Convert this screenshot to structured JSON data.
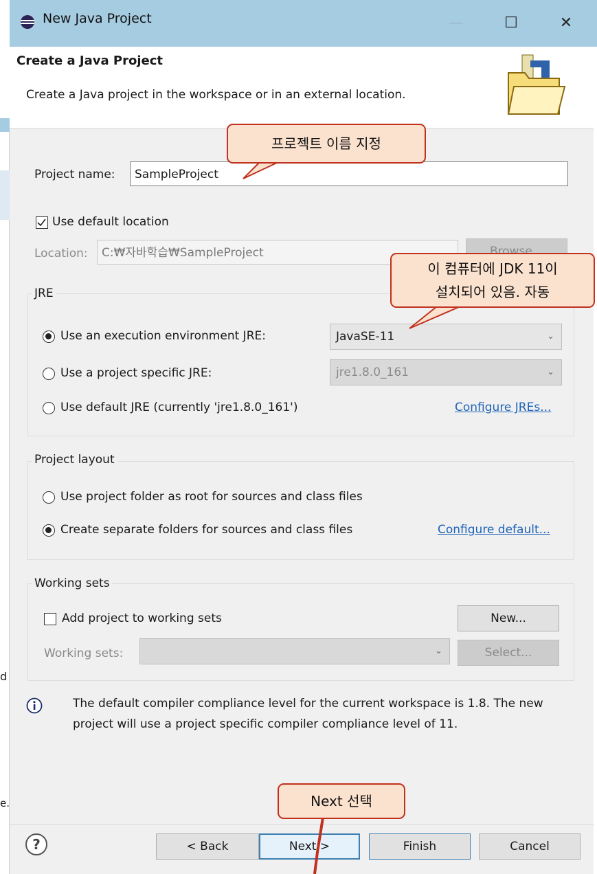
{
  "window": {
    "title": "New Java Project",
    "minimize": "—",
    "maximize": "☐",
    "close": "✕"
  },
  "header": {
    "title": "Create a Java Project",
    "description": "Create a Java project in the workspace or in an external location."
  },
  "project_name": {
    "label": "Project name:",
    "value": "SampleProject"
  },
  "location": {
    "use_default_label": "Use default location",
    "use_default_checked": true,
    "label": "Location:",
    "value": "C:₩자바학습₩SampleProject",
    "browse": "Browse..."
  },
  "jre": {
    "group": "JRE",
    "opt_env": "Use an execution environment JRE:",
    "opt_env_value": "JavaSE-11",
    "opt_project": "Use a project specific JRE:",
    "opt_project_value": "jre1.8.0_161",
    "opt_default": "Use default JRE (currently 'jre1.8.0_161')",
    "configure": "Configure JREs..."
  },
  "layout": {
    "group": "Project layout",
    "opt_root": "Use project folder as root for sources and class files",
    "opt_separate": "Create separate folders for sources and class files",
    "configure": "Configure default..."
  },
  "working_sets": {
    "group": "Working sets",
    "add_label": "Add project to working sets",
    "new": "New...",
    "label": "Working sets:",
    "select": "Select..."
  },
  "info": {
    "text": "The default compiler compliance level for the current workspace is 1.8. The new project will use a project specific compiler compliance level of 11."
  },
  "buttons": {
    "back": "< Back",
    "next": "Next >",
    "finish": "Finish",
    "cancel": "Cancel"
  },
  "callouts": {
    "name": "프로젝트 이름 지정",
    "jdk_line1": "이 컴퓨터에 JDK 11이",
    "jdk_line2": "설치되어 있음. 자동",
    "next": "Next 선택"
  },
  "background": {
    "left_edge_text1": "d",
    "left_edge_text2": "e.."
  },
  "colors": {
    "titlebar": "#a6cce2",
    "dialog_bg": "#f0f0f0",
    "callout_fill": "#fbe2cf",
    "callout_border": "#c0311e",
    "link": "#1d63b8"
  }
}
